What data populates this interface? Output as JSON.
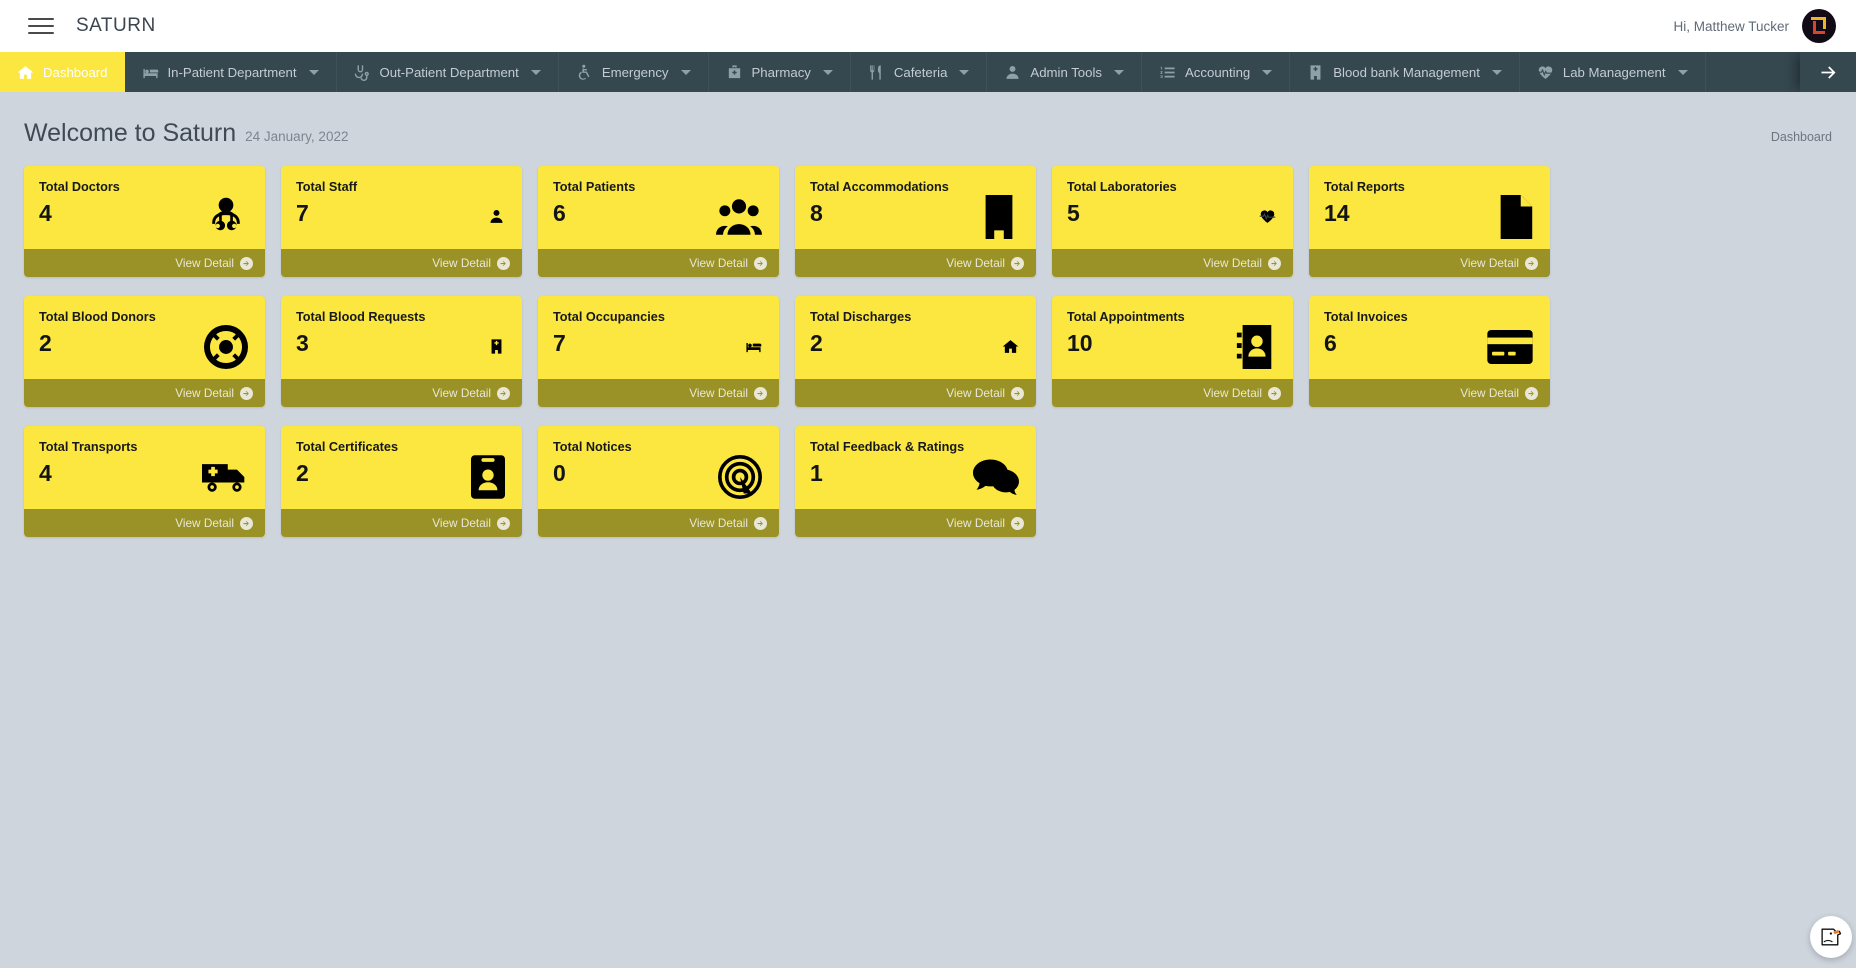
{
  "topbar": {
    "brand": "SATURN",
    "greeting": "Hi, Matthew Tucker",
    "menu_icon": "hamburger-menu-icon",
    "avatar_icon": "user-avatar"
  },
  "nav": {
    "items": [
      {
        "label": "Dashboard",
        "icon": "home-icon",
        "active": true,
        "caret": false
      },
      {
        "label": "In-Patient Department",
        "icon": "bed-icon",
        "active": false,
        "caret": true
      },
      {
        "label": "Out-Patient Department",
        "icon": "stethoscope-icon",
        "active": false,
        "caret": true
      },
      {
        "label": "Emergency",
        "icon": "wheelchair-icon",
        "active": false,
        "caret": true
      },
      {
        "label": "Pharmacy",
        "icon": "medkit-icon",
        "active": false,
        "caret": true
      },
      {
        "label": "Cafeteria",
        "icon": "cutlery-icon",
        "active": false,
        "caret": true
      },
      {
        "label": "Admin Tools",
        "icon": "user-icon",
        "active": false,
        "caret": true
      },
      {
        "label": "Accounting",
        "icon": "list-ol-icon",
        "active": false,
        "caret": true
      },
      {
        "label": "Blood bank Management",
        "icon": "hospital-icon",
        "active": false,
        "caret": true
      },
      {
        "label": "Lab Management",
        "icon": "heartbeat-icon",
        "active": false,
        "caret": true
      }
    ],
    "next_icon": "arrow-right-icon"
  },
  "page": {
    "title": "Welcome to Saturn",
    "date": "24 January, 2022",
    "breadcrumb": "Dashboard"
  },
  "colors": {
    "card_bg": "#fbe73f",
    "card_foot_bg": "#9a9226",
    "nav_bg": "#35474f",
    "page_bg": "#cfd5dd",
    "accent": "#fbe73f"
  },
  "cards": [
    {
      "label": "Total Doctors",
      "value": "4",
      "icon": "doctor-icon",
      "action": "View Detail"
    },
    {
      "label": "Total Staff",
      "value": "7",
      "icon": "user-icon",
      "action": "View Detail"
    },
    {
      "label": "Total Patients",
      "value": "6",
      "icon": "users-icon",
      "action": "View Detail"
    },
    {
      "label": "Total Accommodations",
      "value": "8",
      "icon": "building-icon",
      "action": "View Detail"
    },
    {
      "label": "Total Laboratories",
      "value": "5",
      "icon": "heartbeat-icon",
      "action": "View Detail"
    },
    {
      "label": "Total Reports",
      "value": "14",
      "icon": "file-icon",
      "action": "View Detail"
    },
    {
      "label": "Total Blood Donors",
      "value": "2",
      "icon": "lifebuoy-icon",
      "action": "View Detail"
    },
    {
      "label": "Total Blood Requests",
      "value": "3",
      "icon": "hospital-icon",
      "action": "View Detail"
    },
    {
      "label": "Total Occupancies",
      "value": "7",
      "icon": "bed-icon",
      "action": "View Detail"
    },
    {
      "label": "Total Discharges",
      "value": "2",
      "icon": "home-icon",
      "action": "View Detail"
    },
    {
      "label": "Total Appointments",
      "value": "10",
      "icon": "address-book-icon",
      "action": "View Detail"
    },
    {
      "label": "Total Invoices",
      "value": "6",
      "icon": "credit-card-icon",
      "action": "View Detail"
    },
    {
      "label": "Total Transports",
      "value": "4",
      "icon": "ambulance-icon",
      "action": "View Detail"
    },
    {
      "label": "Total Certificates",
      "value": "2",
      "icon": "id-card-icon",
      "action": "View Detail"
    },
    {
      "label": "Total Notices",
      "value": "0",
      "icon": "bullhorn-icon",
      "action": "View Detail"
    },
    {
      "label": "Total Feedback & Ratings",
      "value": "1",
      "icon": "comments-icon",
      "action": "View Detail"
    }
  ],
  "fab": {
    "icon": "duck-assistant-icon"
  }
}
